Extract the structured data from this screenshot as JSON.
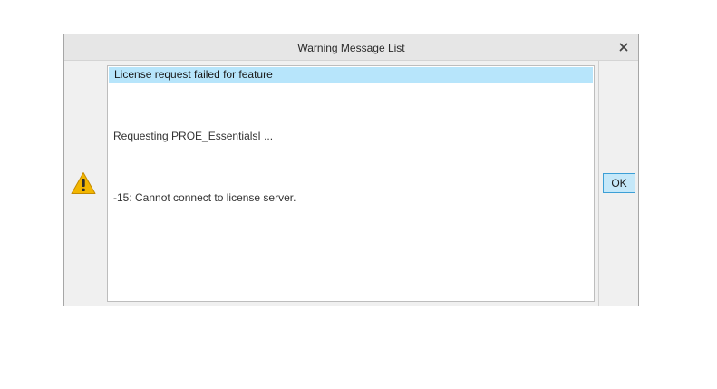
{
  "dialog": {
    "title": "Warning Message List",
    "close_icon": "close-icon",
    "warning_icon": "warning-icon",
    "accent_color": "#b7e5fb",
    "messages": [
      "License request failed for feature",
      "Requesting PROE_EssentialsI ...",
      "-15: Cannot connect to license server."
    ],
    "ok_label": "OK"
  }
}
